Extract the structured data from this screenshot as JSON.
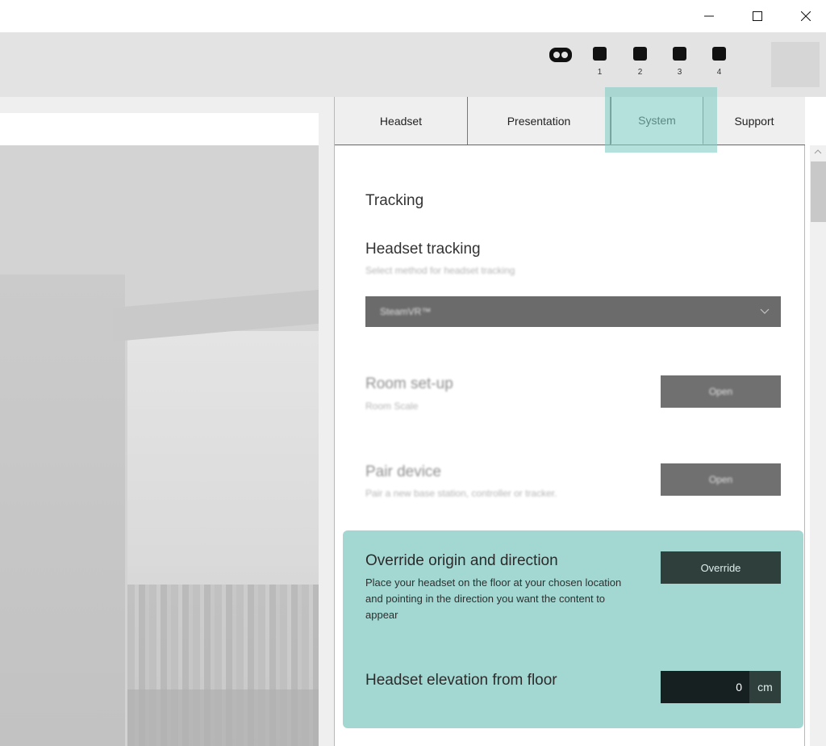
{
  "window_controls": {
    "minimize_icon": "minimize-icon",
    "maximize_icon": "maximize-icon",
    "close_icon": "close-icon"
  },
  "toolbar": {
    "headset_icon": "vr-headset-icon",
    "slots": [
      {
        "label": "1"
      },
      {
        "label": "2"
      },
      {
        "label": "3"
      },
      {
        "label": "4"
      }
    ]
  },
  "tabs": [
    {
      "label": "Headset",
      "active": false
    },
    {
      "label": "Presentation",
      "active": false
    },
    {
      "label": "System",
      "active": true
    },
    {
      "label": "Support",
      "active": false
    }
  ],
  "content": {
    "section_title": "Tracking",
    "headset_tracking": {
      "title": "Headset tracking",
      "subtitle": "Select method for headset tracking",
      "selected": "SteamVR™"
    },
    "room_setup": {
      "title": "Room set-up",
      "subtitle": "Room Scale",
      "button": "Open"
    },
    "pair_device": {
      "title": "Pair device",
      "subtitle": "Pair a new base station, controller or tracker.",
      "button": "Open"
    },
    "override": {
      "title": "Override origin and direction",
      "description": "Place your headset on the floor at your chosen location and pointing in the direction you want the content to appear",
      "button": "Override"
    },
    "elevation": {
      "title": "Headset elevation from floor",
      "value": "0",
      "unit": "cm"
    }
  },
  "colors": {
    "highlight": "#a3d8d2",
    "dark_button": "#2e3f3c",
    "input_bg": "#162020"
  }
}
